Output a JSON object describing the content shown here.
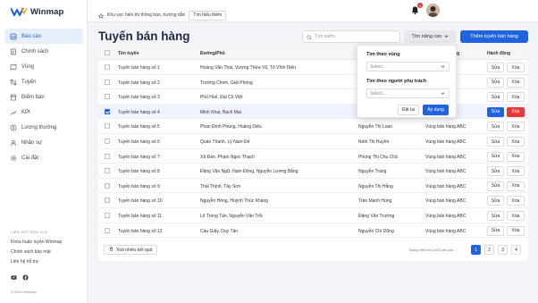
{
  "brand": {
    "name": "Winmap",
    "accent": "#1f63e0"
  },
  "topbar": {
    "notice": "Khu vực hiển thị thông báo, hướng dẫn",
    "learn_more": "Tìm hiểu thêm",
    "notification_count": "1"
  },
  "sidebar": {
    "items": [
      {
        "label": "Báo cáo",
        "icon": "report-icon",
        "active": true
      },
      {
        "label": "Chính sách",
        "icon": "policy-icon",
        "active": false
      },
      {
        "label": "Vùng",
        "icon": "region-icon",
        "active": false
      },
      {
        "label": "Tuyến",
        "icon": "route-icon",
        "active": false
      },
      {
        "label": "Điểm bán",
        "icon": "store-icon",
        "active": false
      },
      {
        "label": "KPI",
        "icon": "kpi-icon",
        "active": false
      },
      {
        "label": "Lương thưởng",
        "icon": "salary-icon",
        "active": false
      },
      {
        "label": "Nhân sự",
        "icon": "staff-icon",
        "active": false
      },
      {
        "label": "Cài đặt",
        "icon": "settings-icon",
        "active": false
      }
    ],
    "links_title": "LIÊN KẾT HỮU ÍCH",
    "links": [
      "Khóa huấn luyện Winmap",
      "Chính sách bảo mật",
      "Liên hệ hỗ trợ"
    ],
    "copyright": "© 2023 Winmap"
  },
  "page": {
    "title": "Tuyến bán hàng",
    "search_placeholder": "Tìm kiếm",
    "advanced_label": "Tìm nâng cao",
    "add_label": "Thêm tuyến bán hàng"
  },
  "table": {
    "headers": {
      "name": "Tên tuyến",
      "street": "Đường/Phố",
      "staff": "",
      "region": "ng",
      "actions": "Hành động"
    },
    "edit_label": "Sửa",
    "delete_label": "Xóa",
    "rows": [
      {
        "name": "Tuyến bán hàng số 1",
        "street": "Hoàng Văn Thái, Vương Thừa Vũ, Tô Vĩnh Diện",
        "staff": "",
        "region": "",
        "selected": false
      },
      {
        "name": "Tuyến bán hàng số 2",
        "street": "Trường Chinh, Giải Phóng",
        "staff": "",
        "region": "",
        "selected": false
      },
      {
        "name": "Tuyến bán hàng số 3",
        "street": "Phố Huế, Đại Cồ Việt",
        "staff": "",
        "region": "",
        "selected": false
      },
      {
        "name": "Tuyến bán hàng số 4",
        "street": "Minh Khai, Bạch Mai",
        "staff": "",
        "region": "",
        "selected": true
      },
      {
        "name": "Tuyến bán hàng số 5",
        "street": "Phan Đình Phùng, Hoàng Diệu",
        "staff": "Nguyễn Thị Loan",
        "region": "Vùng bán hàng ABC",
        "selected": false
      },
      {
        "name": "Tuyến bán hàng số 6",
        "street": "Quán Thánh, Lý Nam Đế",
        "staff": "Ninh Thị Huyền",
        "region": "Vùng bán hàng ABC",
        "selected": false
      },
      {
        "name": "Tuyến bán hàng số 7",
        "street": "Xã Đàn, Phạm Ngọc Thạch",
        "staff": "Phùng Thị Chu Chả",
        "region": "Vùng bán hàng ABC",
        "selected": false
      },
      {
        "name": "Tuyến bán hàng số 8",
        "street": "Đặng Văn Ngữ, Nam Đồng, Nguyễn Lương Bằng",
        "staff": "Nguyễn Trang",
        "region": "Vùng bán hàng ABC",
        "selected": false
      },
      {
        "name": "Tuyến bán hàng số 9",
        "street": "Thái Thịnh, Tây Sơn",
        "staff": "Nguyễn Thị Hằng",
        "region": "Vùng bán hàng ABC",
        "selected": false
      },
      {
        "name": "Tuyến bán hàng số 10",
        "street": "Nguyễn Hồng, Huỳnh Thúc Kháng",
        "staff": "Trần Mạnh Hùng",
        "region": "Vùng bán hàng ABC",
        "selected": false
      },
      {
        "name": "Tuyến bán hàng số 11",
        "street": "Lê Trọng Tấn, Nguyễn Văn Trỗi",
        "staff": "Đặng Văn Trường",
        "region": "Vùng bán hàng ABC",
        "selected": false
      },
      {
        "name": "Tuyến bán hàng số 12",
        "street": "Cầu Giấy, Duy Tân",
        "staff": "Nguyễn Chí Dũng",
        "region": "Vùng bán hàng ABC",
        "selected": false
      }
    ]
  },
  "footer": {
    "bulk_delete": "Xoá nhiều kết quả",
    "showing": "Đang hiển thị 12/40 kết quả",
    "pages": [
      "1",
      "2",
      "3",
      "4"
    ],
    "active_page": "1"
  },
  "filter_panel": {
    "region_label": "Tìm theo vùng",
    "region_placeholder": "Select..",
    "staff_label": "Tìm theo người phụ trách",
    "staff_placeholder": "Select..",
    "reset": "Đặt lại",
    "apply": "Áp dụng"
  }
}
